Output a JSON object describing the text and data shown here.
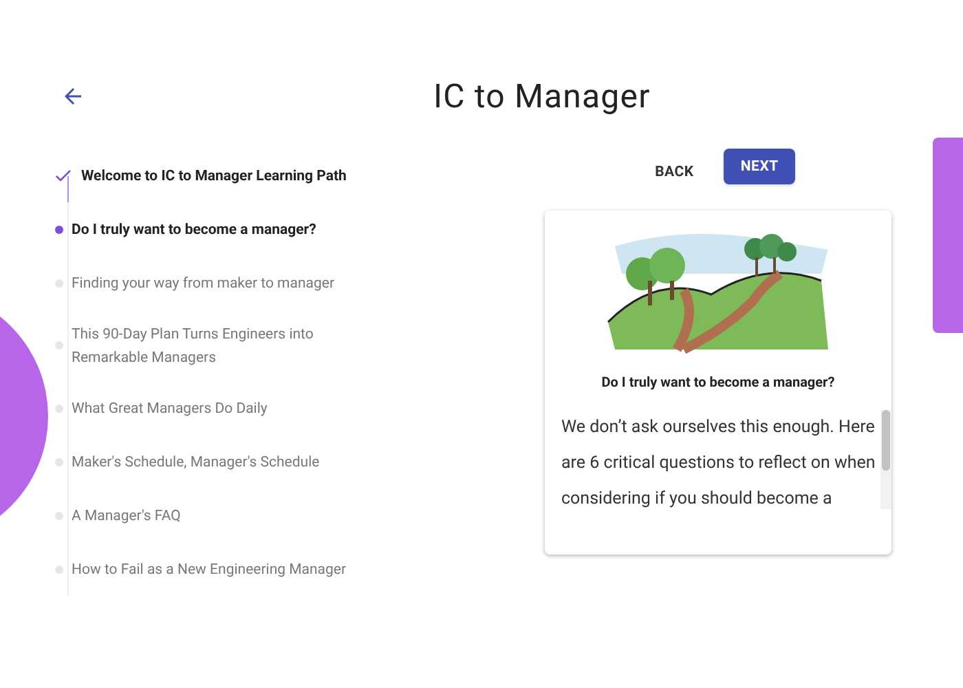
{
  "title": "IC to Manager",
  "steps": [
    {
      "label": "Welcome to IC to Manager Learning Path",
      "completed": true,
      "selected": false
    },
    {
      "label": "Do I truly want to become a manager?",
      "completed": false,
      "selected": true
    },
    {
      "label": "Finding your way from maker to manager",
      "completed": false,
      "selected": false
    },
    {
      "label": "This 90-Day Plan Turns Engineers into Remarkable Managers",
      "completed": false,
      "selected": false
    },
    {
      "label": "What Great Managers Do Daily",
      "completed": false,
      "selected": false
    },
    {
      "label": "Maker's Schedule, Manager's Schedule",
      "completed": false,
      "selected": false
    },
    {
      "label": "A Manager's FAQ",
      "completed": false,
      "selected": false
    },
    {
      "label": "How to Fail as a New Engineering Manager",
      "completed": false,
      "selected": false
    }
  ],
  "buttons": [
    {
      "label": "BACK",
      "kind": "text"
    },
    {
      "label": "NEXT",
      "kind": "primary"
    }
  ],
  "card": {
    "heading": "Do I truly want to become a manager?",
    "body": "We don’t ask ourselves this enough. Here are 6 critical questions to  reflect on when considering if you should become a"
  }
}
